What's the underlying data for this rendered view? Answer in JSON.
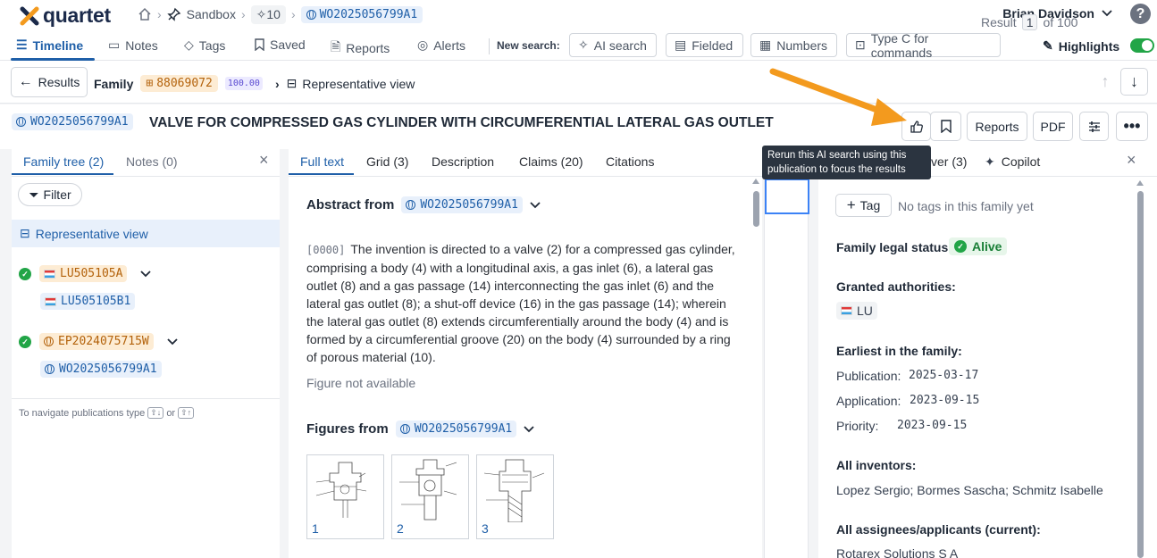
{
  "app": {
    "name": "quartet"
  },
  "breadcrumb": {
    "workspace": "Sandbox",
    "ai_count": "10",
    "pub": "WO2025056799A1"
  },
  "user": {
    "name": "Brian Davidson"
  },
  "nav": {
    "items": [
      "Timeline",
      "Notes",
      "Tags",
      "Saved",
      "Reports",
      "Alerts"
    ],
    "new_search_label": "New search:",
    "search_buttons": [
      "AI search",
      "Fielded",
      "Numbers",
      "Type C for commands"
    ],
    "highlights": "Highlights"
  },
  "result_bar": {
    "results_btn": "Results",
    "family_label": "Family",
    "family_id": "88069072",
    "score": "100.00",
    "rep_view": "Representative view",
    "result_label": "Result",
    "result_num": "1",
    "of_total": "of 100"
  },
  "title_bar": {
    "pub": "WO2025056799A1",
    "title": "VALVE FOR COMPRESSED GAS CYLINDER WITH CIRCUMFERENTIAL LATERAL GAS OUTLET",
    "reports": "Reports",
    "pdf": "PDF"
  },
  "tooltip": "Rerun this AI search using this publication to focus the results",
  "left_panel": {
    "tabs": [
      "Family tree (2)",
      "Notes (0)"
    ],
    "filter": "Filter",
    "rep_view": "Representative view",
    "tree": [
      {
        "pub": "LU505105A",
        "child": "LU505105B1"
      },
      {
        "pub": "EP2024075715W",
        "child": "WO2025056799A1"
      }
    ],
    "hint_prefix": "To navigate publications type",
    "hint_or": "or"
  },
  "center_panel": {
    "tabs": [
      "Full text",
      "Grid (3)",
      "Description",
      "Claims (20)",
      "Citations"
    ],
    "abstract_heading": "Abstract from",
    "abstract_pub": "WO2025056799A1",
    "para_num": "[0000]",
    "abstract_text": "The invention is directed to a valve (2) for a compressed gas cylinder, comprising a body (4) with a longitudinal axis, a gas inlet (6), a lateral gas outlet (8) and a gas passage (14) interconnecting the gas inlet (6) and the lateral gas outlet (8); a shut-off device (16) in the gas passage (14); wherein the lateral gas outlet (8) extends circumferentially around the body (4) and is formed by a circumferential groove (20) on the body (4) surrounded by a ring of porous material (10).",
    "figure_na": "Figure not available",
    "figures_heading": "Figures from",
    "figures_pub": "WO2025056799A1",
    "figures": [
      "1",
      "2",
      "3"
    ]
  },
  "right_panel": {
    "tabs": [
      "ver (3)",
      "Copilot"
    ],
    "tag_btn": "Tag",
    "no_tags": "No tags in this family yet",
    "legal_status_label": "Family legal status:",
    "legal_status": "Alive",
    "granted_label": "Granted authorities:",
    "granted": "LU",
    "earliest_label": "Earliest in the family:",
    "publication_label": "Publication:",
    "publication_date": "2025-03-17",
    "application_label": "Application:",
    "application_date": "2023-09-15",
    "priority_label": "Priority:",
    "priority_date": "2023-09-15",
    "inventors_label": "All inventors:",
    "inventors": "Lopez Sergio; Bormes Sascha; Schmitz Isabelle",
    "assignees_label": "All assignees/applicants (current):",
    "assignees": "Rotarex Solutions S A"
  },
  "colors": {
    "accent": "#1f5fa8",
    "success": "#22a547",
    "family": "#b3620b",
    "arrow": "#f39a1e"
  }
}
